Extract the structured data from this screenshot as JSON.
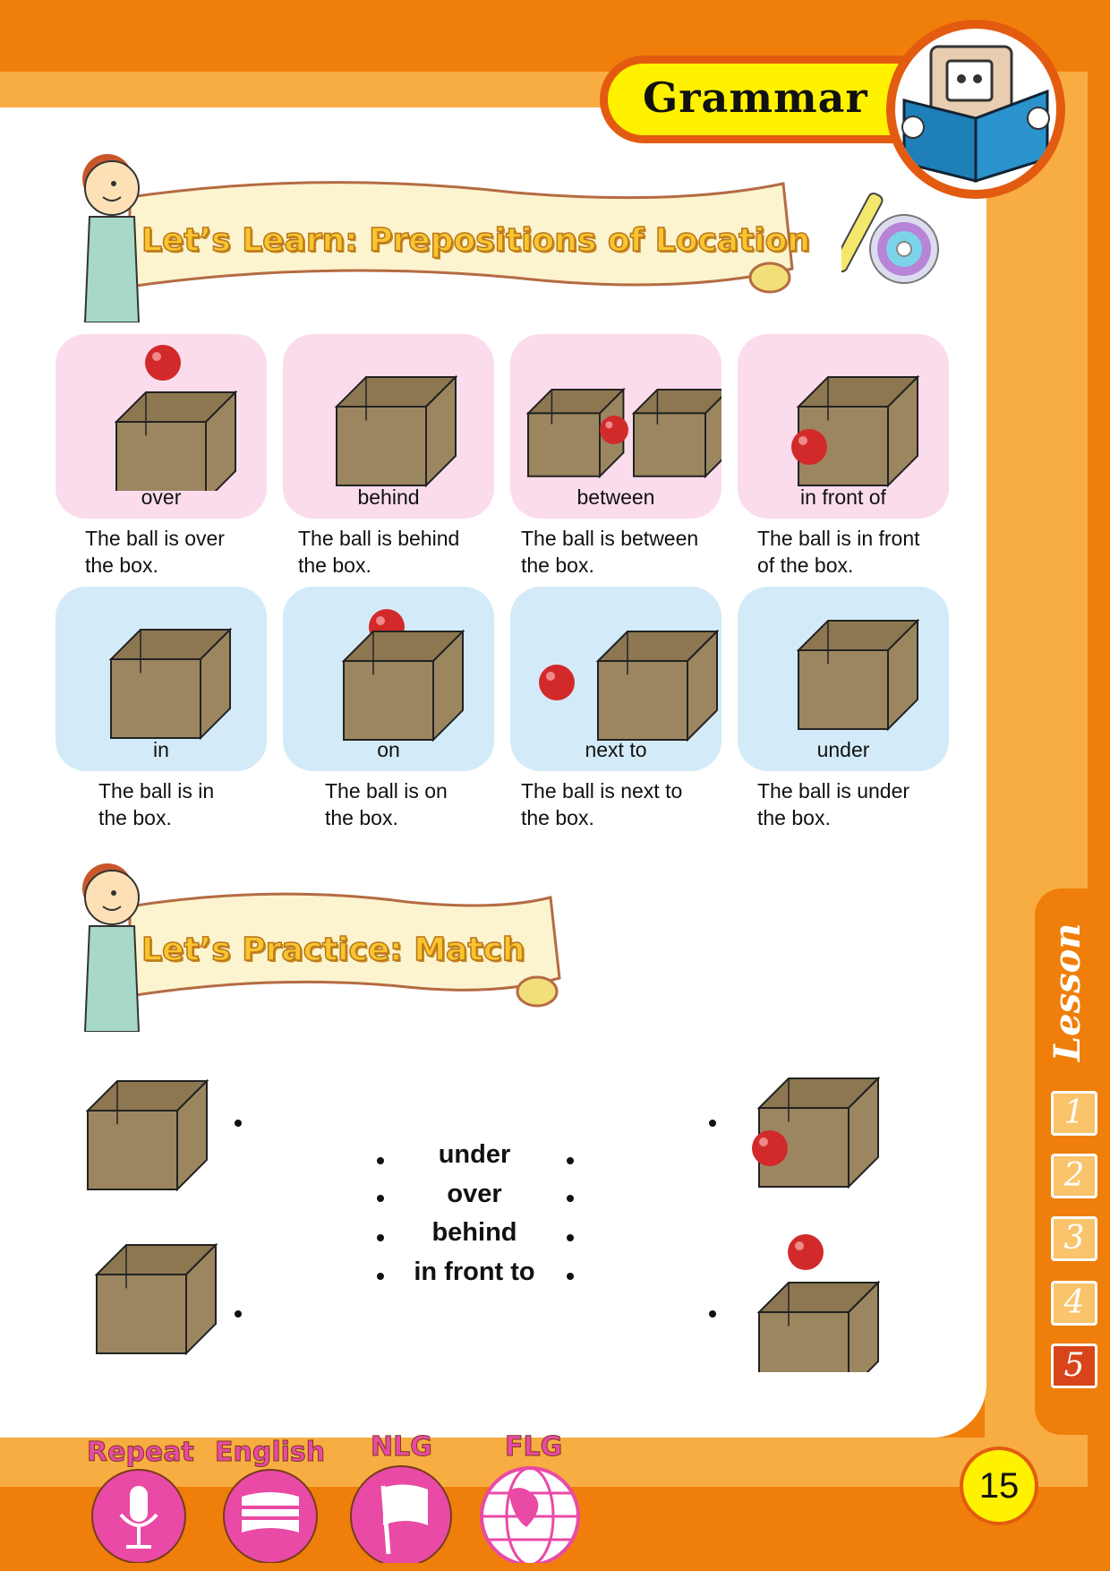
{
  "header": {
    "section_title": "Grammar"
  },
  "learn": {
    "title": "Let’s Learn: Prepositions of Location",
    "cards": [
      {
        "label": "over",
        "sentence_line1": "The ball is over",
        "sentence_line2": "the box."
      },
      {
        "label": "behind",
        "sentence_line1": "The ball is behind",
        "sentence_line2": "the box."
      },
      {
        "label": "between",
        "sentence_line1": "The ball is between",
        "sentence_line2": "the box."
      },
      {
        "label": "in front of",
        "sentence_line1": "The ball is in front",
        "sentence_line2": "of the box."
      },
      {
        "label": "in",
        "sentence_line1": "The ball is in",
        "sentence_line2": "the box."
      },
      {
        "label": "on",
        "sentence_line1": "The ball is on",
        "sentence_line2": "the box."
      },
      {
        "label": "next to",
        "sentence_line1": "The ball is next to",
        "sentence_line2": "the box."
      },
      {
        "label": "under",
        "sentence_line1": "The ball is under",
        "sentence_line2": "the box."
      }
    ]
  },
  "practice": {
    "title": "Let’s Practice: Match",
    "words": [
      "under",
      "over",
      "behind",
      "in front to"
    ]
  },
  "lesson_tab": {
    "word": "Lesson",
    "numbers": [
      "1",
      "2",
      "3",
      "4",
      "5"
    ],
    "active": "5"
  },
  "footer": {
    "icons": [
      "Repeat",
      "English",
      "NLG",
      "FLG"
    ],
    "page_number": "15"
  },
  "colors": {
    "orange": "#ef7f0a",
    "light_orange": "#f7ad42",
    "pink_card": "#fbdcec",
    "blue_card": "#d3ebf8",
    "box": "#9c8660",
    "ball": "#d22a2a",
    "footer_icon": "#e94aa6"
  }
}
